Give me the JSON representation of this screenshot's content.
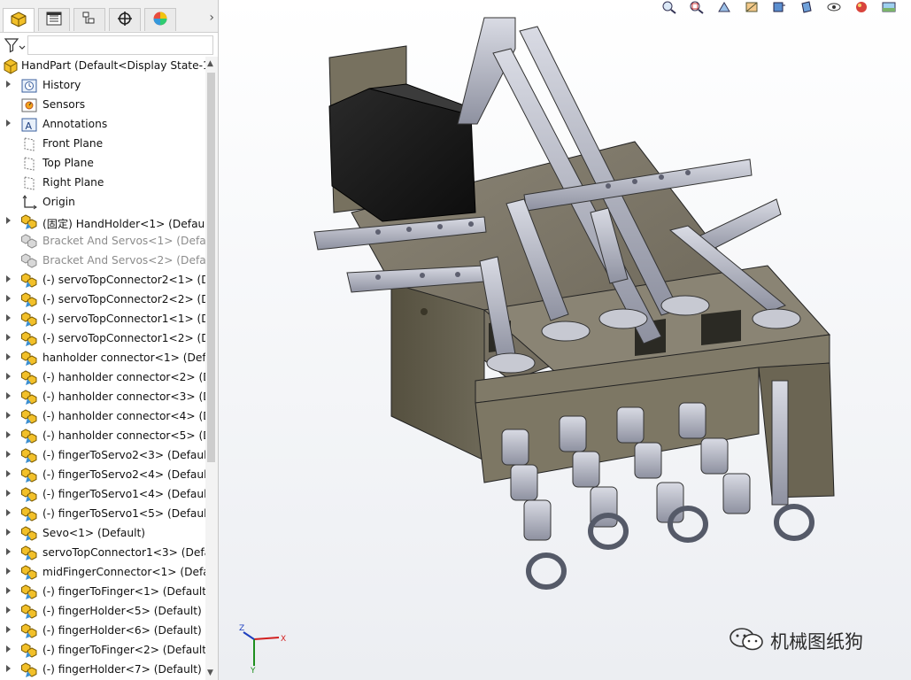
{
  "app": {
    "accent_color": "#1e5aa8"
  },
  "tabs": [
    {
      "name": "feature-manager-tab-icon",
      "active": true
    },
    {
      "name": "property-manager-tab-icon",
      "active": false
    },
    {
      "name": "configuration-manager-tab-icon",
      "active": false
    },
    {
      "name": "dimxpert-tab-icon",
      "active": false
    },
    {
      "name": "display-manager-tab-icon",
      "active": false
    }
  ],
  "filter": {
    "icon": "filter-icon",
    "value": ""
  },
  "tree": {
    "root": {
      "label": "HandPart  (Default<Display State-1",
      "icon": "part-icon"
    },
    "items": [
      {
        "label": "History",
        "icon": "history-icon",
        "expander": true,
        "grey": false
      },
      {
        "label": "Sensors",
        "icon": "sensors-icon",
        "expander": false,
        "grey": false
      },
      {
        "label": "Annotations",
        "icon": "annotations-icon",
        "expander": true,
        "grey": false
      },
      {
        "label": "Front Plane",
        "icon": "plane-icon",
        "expander": false,
        "grey": false
      },
      {
        "label": "Top Plane",
        "icon": "plane-icon",
        "expander": false,
        "grey": false
      },
      {
        "label": "Right Plane",
        "icon": "plane-icon",
        "expander": false,
        "grey": false
      },
      {
        "label": "Origin",
        "icon": "origin-icon",
        "expander": false,
        "grey": false
      },
      {
        "label": "(固定) HandHolder<1> (Default",
        "icon": "component-icon",
        "expander": true,
        "grey": false
      },
      {
        "label": "Bracket And Servos<1> (Defau",
        "icon": "component-icon",
        "expander": false,
        "grey": true
      },
      {
        "label": "Bracket And Servos<2> (Defau",
        "icon": "component-icon",
        "expander": false,
        "grey": true
      },
      {
        "label": "(-) servoTopConnector2<1> (De",
        "icon": "component-icon",
        "expander": true,
        "grey": false
      },
      {
        "label": "(-) servoTopConnector2<2> (De",
        "icon": "component-icon",
        "expander": true,
        "grey": false
      },
      {
        "label": "(-) servoTopConnector1<1> (De",
        "icon": "component-icon",
        "expander": true,
        "grey": false
      },
      {
        "label": "(-) servoTopConnector1<2> (De",
        "icon": "component-icon",
        "expander": true,
        "grey": false
      },
      {
        "label": "hanholder connector<1> (Defa",
        "icon": "component-icon",
        "expander": true,
        "grey": false
      },
      {
        "label": "(-) hanholder connector<2> (De",
        "icon": "component-icon",
        "expander": true,
        "grey": false
      },
      {
        "label": "(-) hanholder connector<3> (De",
        "icon": "component-icon",
        "expander": true,
        "grey": false
      },
      {
        "label": "(-) hanholder connector<4> (De",
        "icon": "component-icon",
        "expander": true,
        "grey": false
      },
      {
        "label": "(-) hanholder connector<5> (De",
        "icon": "component-icon",
        "expander": true,
        "grey": false
      },
      {
        "label": "(-) fingerToServo2<3> (Default",
        "icon": "component-icon",
        "expander": true,
        "grey": false
      },
      {
        "label": "(-) fingerToServo2<4> (Default",
        "icon": "component-icon",
        "expander": true,
        "grey": false
      },
      {
        "label": "(-) fingerToServo1<4> (Default)",
        "icon": "component-icon",
        "expander": true,
        "grey": false
      },
      {
        "label": "(-) fingerToServo1<5> (Default)",
        "icon": "component-icon",
        "expander": true,
        "grey": false
      },
      {
        "label": "Sevo<1> (Default)",
        "icon": "component-icon",
        "expander": true,
        "grey": false
      },
      {
        "label": "servoTopConnector1<3> (Defa",
        "icon": "component-icon",
        "expander": true,
        "grey": false
      },
      {
        "label": "midFingerConnector<1> (Defau",
        "icon": "component-icon",
        "expander": true,
        "grey": false
      },
      {
        "label": "(-) fingerToFinger<1> (Default)",
        "icon": "component-icon",
        "expander": true,
        "grey": false
      },
      {
        "label": "(-) fingerHolder<5> (Default)",
        "icon": "component-icon",
        "expander": true,
        "grey": false
      },
      {
        "label": "(-) fingerHolder<6> (Default)",
        "icon": "component-icon",
        "expander": true,
        "grey": false
      },
      {
        "label": "(-) fingerToFinger<2> (Default)",
        "icon": "component-icon",
        "expander": true,
        "grey": false
      },
      {
        "label": "(-) fingerHolder<7> (Default)",
        "icon": "component-icon",
        "expander": true,
        "grey": false
      }
    ]
  },
  "viewport": {
    "heads_up_icons": [
      "zoom-to-fit-icon",
      "zoom-to-area-icon",
      "previous-view-icon",
      "section-view-icon",
      "view-orientation-icon",
      "display-style-icon",
      "hide-show-icon",
      "appearance-icon",
      "scene-icon"
    ],
    "triad_axes": [
      "X",
      "Y",
      "Z"
    ],
    "watermark": {
      "icon": "wechat-icon",
      "text": "机械图纸狗"
    }
  }
}
